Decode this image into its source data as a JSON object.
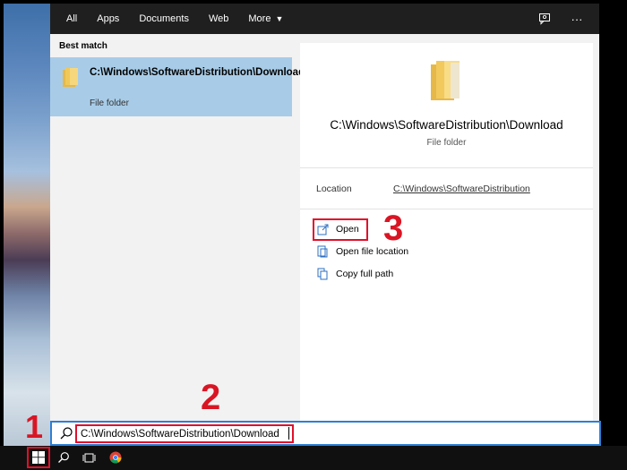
{
  "topbar": {
    "tabs": [
      "All",
      "Apps",
      "Documents",
      "Web",
      "More"
    ],
    "icons": [
      "feedback-icon",
      "ellipsis-icon"
    ],
    "ellipsis": "···"
  },
  "results": {
    "section_label": "Best match",
    "item": {
      "title": "C:\\Windows\\SoftwareDistribution\\Download",
      "subtitle": "File folder"
    }
  },
  "preview": {
    "title": "C:\\Windows\\SoftwareDistribution\\Download",
    "type": "File folder",
    "location_label": "Location",
    "location_value": "C:\\Windows\\SoftwareDistribution",
    "actions": [
      {
        "label": "Open",
        "icon": "open-icon"
      },
      {
        "label": "Open file location",
        "icon": "open-file-location-icon"
      },
      {
        "label": "Copy full path",
        "icon": "copy-path-icon"
      }
    ]
  },
  "search": {
    "value": "C:\\Windows\\SoftwareDistribution\\Download"
  },
  "steps": [
    "1",
    "2",
    "3"
  ],
  "colors": {
    "accent": "#2d7fd5",
    "selection": "#a8cce8",
    "annotation": "#e0102a",
    "topbar": "#1f1f1f",
    "taskbar": "#101010"
  }
}
